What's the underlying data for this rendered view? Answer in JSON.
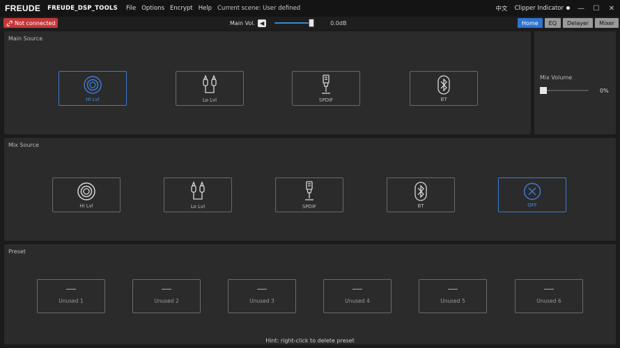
{
  "titlebar": {
    "brand": "FREUDE",
    "app_name": "FREUDE_DSP_TOOLS",
    "menu": [
      "File",
      "Options",
      "Encrypt",
      "Help"
    ],
    "scene": "Current scene: User defined",
    "language": "中文",
    "clipper": "Clipper Indicator",
    "minimize": "—",
    "maximize": "☐",
    "close": "✕"
  },
  "toolbar": {
    "connection": "Not connected",
    "main_vol_label": "Main Vol.",
    "main_vol_value": "0.0dB",
    "main_vol_level": 0.9,
    "tabs": [
      "Home",
      "EQ",
      "Delayer",
      "Mixer"
    ],
    "active_tab": "Home"
  },
  "main_source": {
    "title": "Main Source",
    "buttons": [
      {
        "label": "Hi Lvl",
        "icon": "hi-level-icon",
        "selected": true
      },
      {
        "label": "Lo Lvl",
        "icon": "rca-icon",
        "selected": false
      },
      {
        "label": "SPDIF",
        "icon": "spdif-icon",
        "selected": false
      },
      {
        "label": "BT",
        "icon": "bluetooth-icon",
        "selected": false
      }
    ]
  },
  "mix_volume": {
    "label": "Mix Volume",
    "value": "0%",
    "level": 0
  },
  "mix_source": {
    "title": "Mix Source",
    "buttons": [
      {
        "label": "Hi Lvl",
        "icon": "hi-level-icon",
        "selected": false
      },
      {
        "label": "Lo Lvl",
        "icon": "rca-icon",
        "selected": false
      },
      {
        "label": "SPDIF",
        "icon": "spdif-icon",
        "selected": false
      },
      {
        "label": "BT",
        "icon": "bluetooth-icon",
        "selected": false
      },
      {
        "label": "OFF",
        "icon": "off-icon",
        "selected": true
      }
    ]
  },
  "preset": {
    "title": "Preset",
    "items": [
      "Unused 1",
      "Unused 2",
      "Unused 3",
      "Unused 4",
      "Unused 5",
      "Unused 6"
    ],
    "hint": "Hint: right-click to delete preset"
  },
  "colors": {
    "accent": "#3a7bd5",
    "error": "#c6373a",
    "panel": "#2b2b2b"
  }
}
